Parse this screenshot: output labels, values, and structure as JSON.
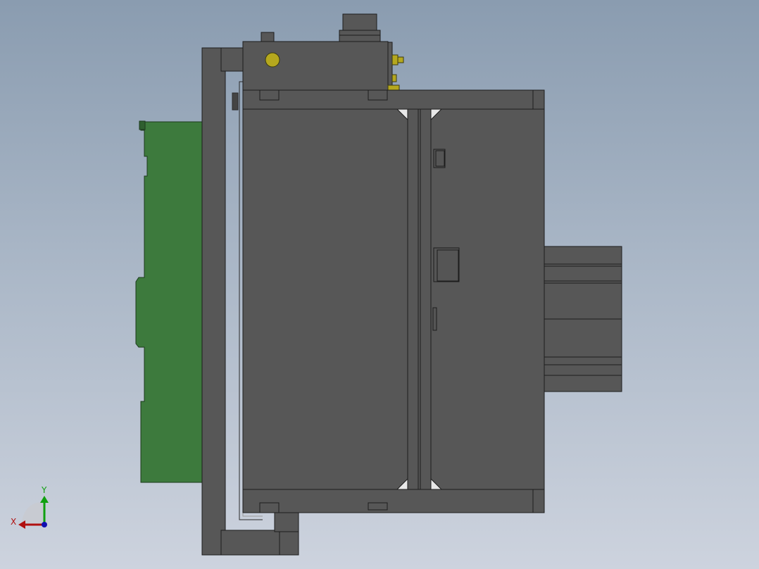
{
  "viewport": {
    "background_top": "#8a9cb0",
    "background_bottom": "#cdd3de"
  },
  "model": {
    "body_color": "#585858",
    "edge_color": "#1c1c1c",
    "board_color": "#3d7a3d",
    "board_edge_color": "#1c3a1c",
    "connector_color": "#b5a81e"
  },
  "triad": {
    "x_label": "X",
    "y_label": "Y",
    "x_color": "#b01010",
    "y_color": "#10a010",
    "z_color": "#1010b0"
  }
}
